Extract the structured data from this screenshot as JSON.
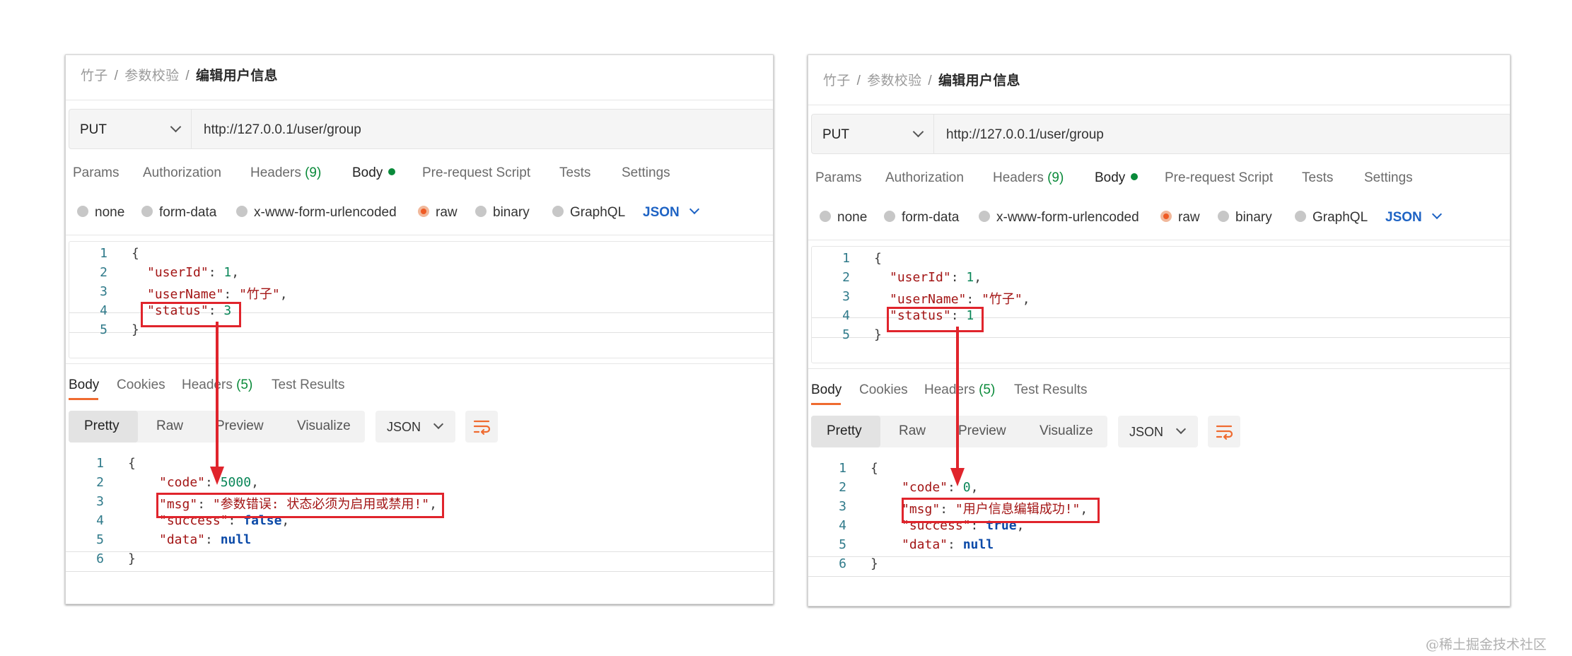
{
  "panels": [
    {
      "breadcrumb": {
        "crumb1": "竹子",
        "crumb2": "参数校验",
        "current": "编辑用户信息",
        "separator": "/"
      },
      "request": {
        "method": "PUT",
        "url": "http://127.0.0.1/user/group"
      },
      "tabs": {
        "params": "Params",
        "authorization": "Authorization",
        "headers": "Headers",
        "headers_count": "(9)",
        "body": "Body",
        "prerequest": "Pre-request Script",
        "tests": "Tests",
        "settings": "Settings"
      },
      "body_types": {
        "none": "none",
        "form_data": "form-data",
        "urlencoded": "x-www-form-urlencoded",
        "raw": "raw",
        "binary": "binary",
        "graphql": "GraphQL",
        "format": "JSON"
      },
      "request_body": {
        "l1": "1",
        "l2": "2",
        "l3": "3",
        "l4": "4",
        "l5": "5",
        "open": "{",
        "close": "}",
        "userId_key": "\"userId\"",
        "userId_val": "1",
        "userName_key": "\"userName\"",
        "userName_val": "\"竹子\"",
        "status_key": "\"status\"",
        "status_val": "3"
      },
      "response_tabs": {
        "body": "Body",
        "cookies": "Cookies",
        "headers": "Headers",
        "headers_count": "(5)",
        "test_results": "Test Results"
      },
      "view_modes": {
        "pretty": "Pretty",
        "raw": "Raw",
        "preview": "Preview",
        "visualize": "Visualize",
        "format": "JSON"
      },
      "response_body": {
        "l1": "1",
        "l2": "2",
        "l3": "3",
        "l4": "4",
        "l5": "5",
        "l6": "6",
        "open": "{",
        "close": "}",
        "code_key": "\"code\"",
        "code_val": "5000",
        "msg_key": "\"msg\"",
        "msg_val": "\"参数错误: 状态必须为启用或禁用!\"",
        "success_key": "\"success\"",
        "success_val": "false",
        "data_key": "\"data\"",
        "data_val": "null"
      }
    },
    {
      "breadcrumb": {
        "crumb1": "竹子",
        "crumb2": "参数校验",
        "current": "编辑用户信息",
        "separator": "/"
      },
      "request": {
        "method": "PUT",
        "url": "http://127.0.0.1/user/group"
      },
      "tabs": {
        "params": "Params",
        "authorization": "Authorization",
        "headers": "Headers",
        "headers_count": "(9)",
        "body": "Body",
        "prerequest": "Pre-request Script",
        "tests": "Tests",
        "settings": "Settings"
      },
      "body_types": {
        "none": "none",
        "form_data": "form-data",
        "urlencoded": "x-www-form-urlencoded",
        "raw": "raw",
        "binary": "binary",
        "graphql": "GraphQL",
        "format": "JSON"
      },
      "request_body": {
        "l1": "1",
        "l2": "2",
        "l3": "3",
        "l4": "4",
        "l5": "5",
        "open": "{",
        "close": "}",
        "userId_key": "\"userId\"",
        "userId_val": "1",
        "userName_key": "\"userName\"",
        "userName_val": "\"竹子\"",
        "status_key": "\"status\"",
        "status_val": "1"
      },
      "response_tabs": {
        "body": "Body",
        "cookies": "Cookies",
        "headers": "Headers",
        "headers_count": "(5)",
        "test_results": "Test Results"
      },
      "view_modes": {
        "pretty": "Pretty",
        "raw": "Raw",
        "preview": "Preview",
        "visualize": "Visualize",
        "format": "JSON"
      },
      "response_body": {
        "l1": "1",
        "l2": "2",
        "l3": "3",
        "l4": "4",
        "l5": "5",
        "l6": "6",
        "open": "{",
        "close": "}",
        "code_key": "\"code\"",
        "code_val": "0",
        "msg_key": "\"msg\"",
        "msg_val": "\"用户信息编辑成功!\"",
        "success_key": "\"success\"",
        "success_val": "true",
        "data_key": "\"data\"",
        "data_val": "null"
      }
    }
  ],
  "colors": {
    "accent": "#ef6b30",
    "highlight_box": "#e0242c",
    "active_dot": "#0a8a3a",
    "json_link": "#1e63c4"
  },
  "watermark": "@稀土掘金技术社区"
}
